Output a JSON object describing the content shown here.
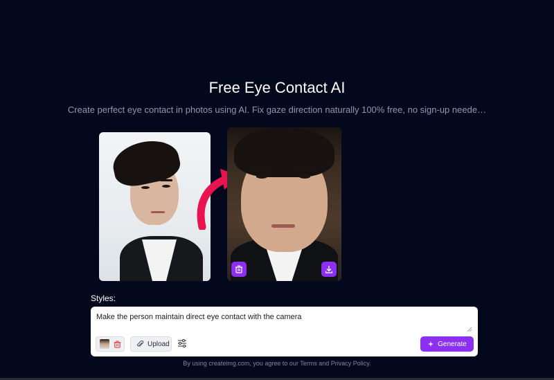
{
  "header": {
    "title": "Free Eye Contact AI",
    "subtitle": "Create perfect eye contact in photos using AI. Fix gaze direction naturally 100% free, no sign-up neede…"
  },
  "preview": {
    "original_alt": "original photo",
    "result_alt": "result photo",
    "delete_icon": "trash-icon",
    "download_icon": "download-icon",
    "arrow_color": "#e8134f"
  },
  "styles": {
    "label": "Styles:",
    "prompt_value": "Make the person maintain direct eye contact with the camera"
  },
  "toolbar": {
    "upload_label": "Upload",
    "generate_label": "Generate"
  },
  "footer": {
    "prefix": "By using createimg.com, you agree to our ",
    "terms": "Terms",
    "and": " and ",
    "privacy": "Privacy Policy",
    "suffix": "."
  },
  "colors": {
    "background": "#04081c",
    "accent": "#8b2ff0",
    "muted_text": "#8e97b3"
  }
}
